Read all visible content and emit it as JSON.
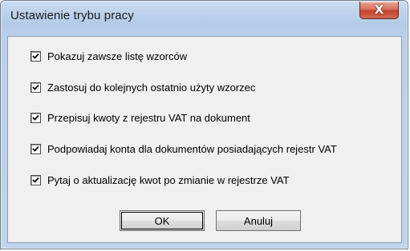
{
  "window": {
    "title": "Ustawienie trybu pracy",
    "close_glyph": "X"
  },
  "options": [
    {
      "label": "Pokazuj zawsze listę wzorców",
      "checked": true
    },
    {
      "label": "Zastosuj do kolejnych ostatnio użyty wzorzec",
      "checked": true
    },
    {
      "label": "Przepisuj kwoty z rejestru VAT na dokument",
      "checked": true
    },
    {
      "label": "Podpowiadaj konta dla dokumentów posiadających rejestr VAT",
      "checked": true
    },
    {
      "label": "Pytaj o aktualizację kwot po zmianie w rejestrze VAT",
      "checked": true
    }
  ],
  "buttons": {
    "ok_label": "OK",
    "cancel_label": "Anuluj"
  }
}
